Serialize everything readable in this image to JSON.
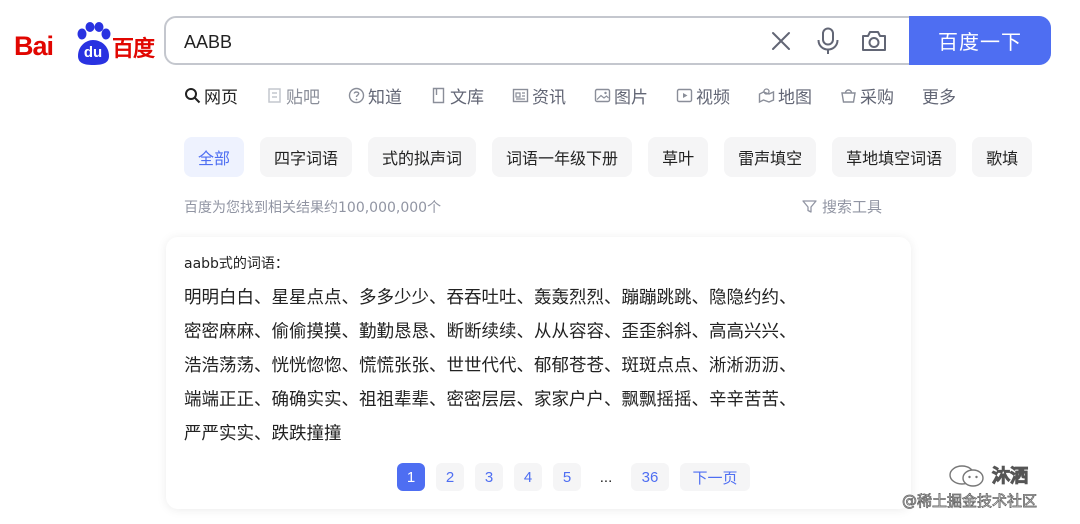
{
  "logo": {
    "bai": "Bai",
    "du": "du",
    "cn": "百度"
  },
  "search": {
    "value": "AABB",
    "button_label": "百度一下"
  },
  "tabs": [
    {
      "label": "网页",
      "icon": "search-icon"
    },
    {
      "label": "贴吧",
      "icon": "tieba-icon"
    },
    {
      "label": "知道",
      "icon": "question-icon"
    },
    {
      "label": "文库",
      "icon": "document-icon"
    },
    {
      "label": "资讯",
      "icon": "news-icon"
    },
    {
      "label": "图片",
      "icon": "image-icon"
    },
    {
      "label": "视频",
      "icon": "video-icon"
    },
    {
      "label": "地图",
      "icon": "map-icon"
    },
    {
      "label": "采购",
      "icon": "purchase-icon"
    },
    {
      "label": "更多"
    }
  ],
  "chips": [
    "全部",
    "四字词语",
    "式的拟声词",
    "词语一年级下册",
    "草叶",
    "雷声填空",
    "草地填空词语",
    "歌填"
  ],
  "results": {
    "count_text": "百度为您找到相关结果约100,000,000个",
    "tools_label": "搜索工具"
  },
  "card": {
    "title": "aabb式的词语：",
    "lines": [
      "明明白白、星星点点、多多少少、吞吞吐吐、轰轰烈烈、蹦蹦跳跳、隐隐约约、",
      "密密麻麻、偷偷摸摸、勤勤恳恳、断断续续、从从容容、歪歪斜斜、高高兴兴、",
      "浩浩荡荡、恍恍惚惚、慌慌张张、世世代代、郁郁苍苍、斑斑点点、淅淅沥沥、",
      "端端正正、确确实实、祖祖辈辈、密密层层、家家户户、飘飘摇摇、辛辛苦苦、",
      "严严实实、跌跌撞撞"
    ],
    "pages": [
      "1",
      "2",
      "3",
      "4",
      "5",
      "...",
      "36",
      "下一页"
    ]
  },
  "watermark": {
    "name": "沐洒",
    "site": "@稀土掘金技术社区"
  },
  "colors": {
    "brand_blue": "#4e6ef2",
    "logo_red": "#e10601",
    "text_muted": "#9195a3"
  }
}
